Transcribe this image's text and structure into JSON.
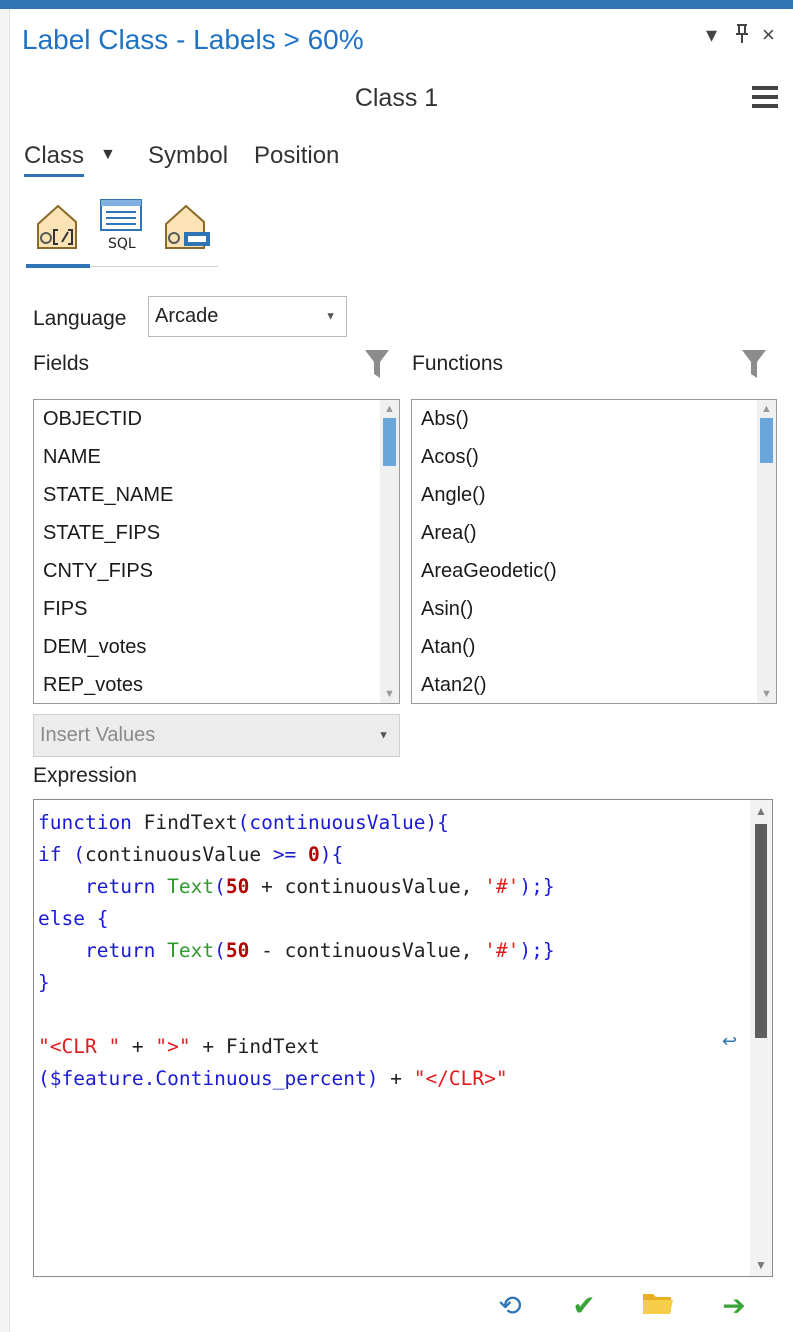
{
  "pane": {
    "title": "Label Class - Labels > 60%",
    "class_name": "Class 1",
    "controls": {
      "options": "▾",
      "pin": "📌",
      "close": "×"
    }
  },
  "tabs": [
    {
      "label": "Class",
      "active": true,
      "has_dropdown": true
    },
    {
      "label": "Symbol",
      "active": false
    },
    {
      "label": "Position",
      "active": false
    }
  ],
  "mode_icons": [
    {
      "name": "label-expression-icon",
      "active": true
    },
    {
      "name": "sql-query-icon",
      "text": "SQL",
      "active": false
    },
    {
      "name": "label-placement-icon",
      "active": false
    }
  ],
  "language": {
    "label": "Language",
    "value": "Arcade"
  },
  "fields": {
    "label": "Fields",
    "items": [
      "OBJECTID",
      "NAME",
      "STATE_NAME",
      "STATE_FIPS",
      "CNTY_FIPS",
      "FIPS",
      "DEM_votes",
      "REP_votes"
    ],
    "scroll_position": 0.0,
    "scroll_visible_fraction": 0.18
  },
  "functions": {
    "label": "Functions",
    "items": [
      "Abs()",
      "Acos()",
      "Angle()",
      "Area()",
      "AreaGeodetic()",
      "Asin()",
      "Atan()",
      "Atan2()"
    ],
    "scroll_position": 0.0,
    "scroll_visible_fraction": 0.17
  },
  "insert_values": {
    "label": "Insert Values",
    "disabled": true
  },
  "expression": {
    "label": "Expression",
    "lines": [
      [
        [
          "kw",
          "function "
        ],
        [
          "txt",
          "FindText"
        ],
        [
          "kw",
          "(continuousValue){"
        ]
      ],
      [
        [
          "kw",
          "if ("
        ],
        [
          "txt",
          "continuousValue "
        ],
        [
          "kw",
          ">= "
        ],
        [
          "num",
          "0"
        ],
        [
          "kw",
          "){"
        ]
      ],
      [
        [
          "txt",
          "    "
        ],
        [
          "kw",
          "return "
        ],
        [
          "fn",
          "Text"
        ],
        [
          "kw",
          "("
        ],
        [
          "num",
          "50"
        ],
        [
          "txt",
          " + continuousValue, "
        ],
        [
          "str",
          "'#'"
        ],
        [
          "kw",
          ");}"
        ]
      ],
      [
        [
          "kw",
          "else {"
        ]
      ],
      [
        [
          "txt",
          "    "
        ],
        [
          "kw",
          "return "
        ],
        [
          "fn",
          "Text"
        ],
        [
          "kw",
          "("
        ],
        [
          "num",
          "50"
        ],
        [
          "txt",
          " - continuousValue, "
        ],
        [
          "str",
          "'#'"
        ],
        [
          "kw",
          ");}"
        ]
      ],
      [
        [
          "kw",
          "}"
        ]
      ],
      [
        [
          "txt",
          ""
        ]
      ],
      [
        [
          "str",
          "\"<CLR \""
        ],
        [
          "txt",
          " + "
        ],
        [
          "str",
          "\">\""
        ],
        [
          "txt",
          " + FindText"
        ]
      ],
      [
        [
          "kw",
          "($feature.Continuous_percent)"
        ],
        [
          "txt",
          " + "
        ],
        [
          "str",
          "\"</CLR>\""
        ]
      ]
    ],
    "wrap_indicator": "↩"
  },
  "actions": {
    "reset": "⟲",
    "apply": "✔",
    "load": "open-folder",
    "save": "➔"
  },
  "colors": {
    "accent": "#2f75b5",
    "title": "#1f72c4",
    "keyword": "#1b1bd6",
    "function": "#2f9a2f",
    "number": "#b40000",
    "string": "#e01b1b",
    "action_blue": "#2f75b5",
    "action_green": "#3aa33a",
    "folder": "#f2c12e"
  }
}
